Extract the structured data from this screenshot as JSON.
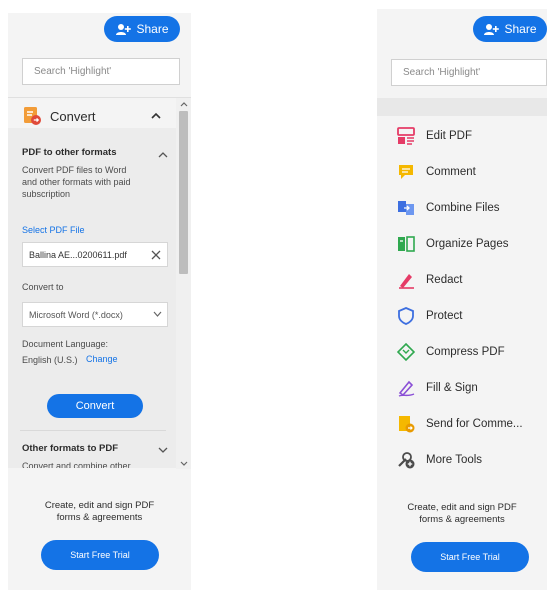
{
  "share_label": "Share",
  "search_placeholder": "Search 'Highlight'",
  "left": {
    "convert_header": "Convert",
    "pdf_to_other": {
      "title": "PDF to other formats",
      "desc_lines": [
        "Convert PDF files to Word",
        "and other formats with paid",
        "subscription"
      ]
    },
    "select_file_label": "Select PDF File",
    "file_name": "Ballina AE...0200611.pdf",
    "convert_to_label": "Convert to",
    "convert_to_value": "Microsoft Word (*.docx)",
    "doc_language_label": "Document Language:",
    "doc_language_value": "English (U.S.)",
    "change_label": "Change",
    "convert_button": "Convert",
    "other_to_pdf": {
      "title": "Other formats to PDF",
      "desc_partial": "Convert and combine other"
    }
  },
  "footer": {
    "line1": "Create, edit and sign PDF",
    "line2": "forms & agreements",
    "trial_button": "Start Free Trial"
  },
  "right": {
    "tools": [
      {
        "label": "Edit PDF",
        "icon": "edit-pdf-icon",
        "color": "#e53b66"
      },
      {
        "label": "Comment",
        "icon": "comment-icon",
        "color": "#f5b800"
      },
      {
        "label": "Combine Files",
        "icon": "combine-files-icon",
        "color": "#3d6fe0"
      },
      {
        "label": "Organize Pages",
        "icon": "organize-pages-icon",
        "color": "#2fa84f"
      },
      {
        "label": "Redact",
        "icon": "redact-icon",
        "color": "#e53b66"
      },
      {
        "label": "Protect",
        "icon": "protect-icon",
        "color": "#3d6fe0"
      },
      {
        "label": "Compress PDF",
        "icon": "compress-pdf-icon",
        "color": "#2fa84f"
      },
      {
        "label": "Fill & Sign",
        "icon": "fill-sign-icon",
        "color": "#8a4fd6"
      },
      {
        "label": "Send for Comme...",
        "icon": "send-for-comment-icon",
        "color": "#f5b800"
      },
      {
        "label": "More Tools",
        "icon": "more-tools-icon",
        "color": "#4b4b4b"
      }
    ]
  },
  "colors": {
    "accent": "#1473e6",
    "panel_bg": "#f4f4f4"
  }
}
